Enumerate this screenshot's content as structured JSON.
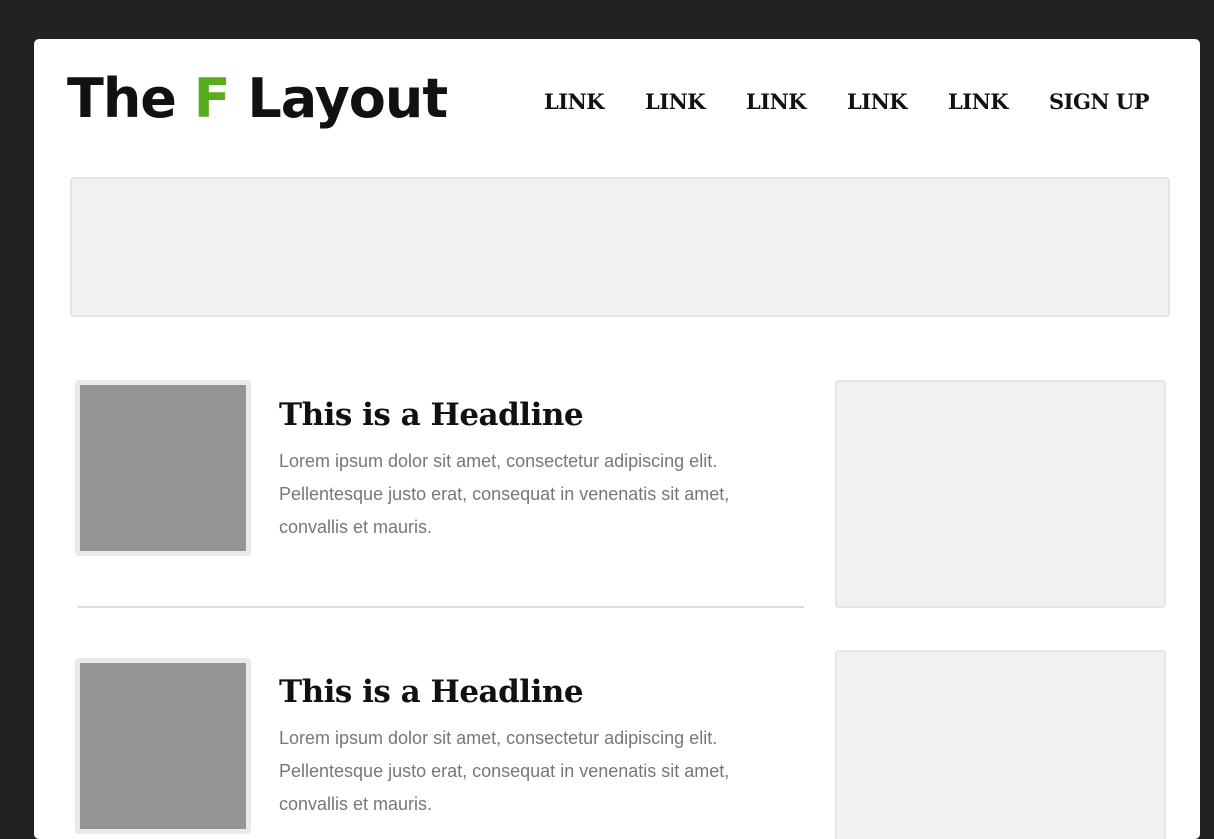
{
  "header": {
    "logo": {
      "prefix": "The ",
      "accent": "F",
      "suffix": " Layout",
      "accent_color": "#5aac1e"
    },
    "nav": {
      "links": [
        "LINK",
        "LINK",
        "LINK",
        "LINK",
        "LINK"
      ],
      "signup": "SIGN UP"
    }
  },
  "articles": [
    {
      "headline": "This is a Headline",
      "body": "Lorem ipsum dolor sit amet, consectetur adipiscing elit. Pellentesque justo erat, consequat in venenatis sit amet, convallis et mauris."
    },
    {
      "headline": "This is a Headline",
      "body": "Lorem ipsum dolor sit amet, consectetur adipiscing elit. Pellentesque justo erat, consequat in venenatis sit amet, convallis et mauris."
    }
  ],
  "colors": {
    "background": "#222222",
    "page": "#ffffff",
    "placeholder": "#f1f1f1",
    "thumbnail": "#959595"
  }
}
